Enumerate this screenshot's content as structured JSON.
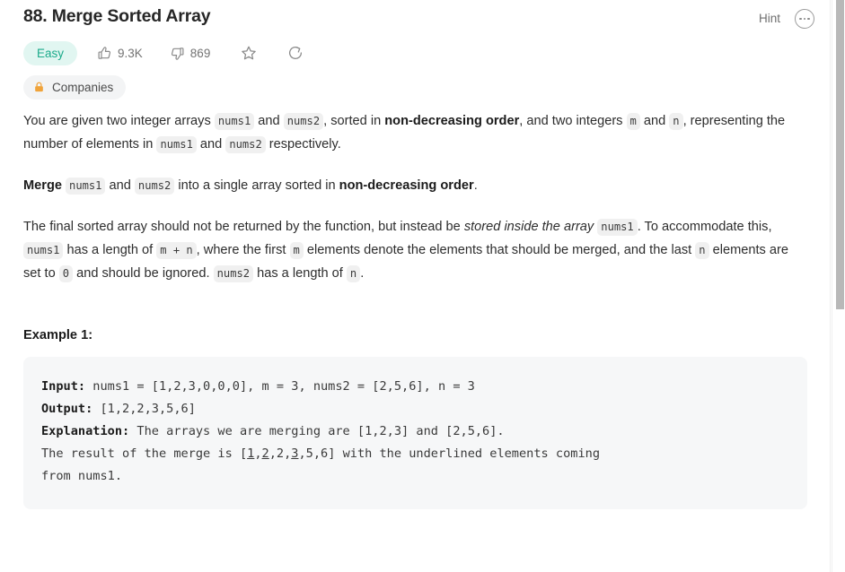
{
  "header": {
    "title": "88. Merge Sorted Array",
    "hint_label": "Hint",
    "more_icon": "ellipsis-circle-icon"
  },
  "meta": {
    "difficulty": "Easy",
    "difficulty_color": "#1cab8b",
    "difficulty_bg": "#e1f6f1",
    "upvotes": "9.3K",
    "downvotes": "869",
    "star_icon": "star-icon",
    "share_icon": "share-icon",
    "thumbs_up_icon": "thumbs-up-icon",
    "thumbs_down_icon": "thumbs-down-icon"
  },
  "tags": {
    "companies_label": "Companies",
    "lock_icon": "lock-icon",
    "lock_color": "#f0a33a"
  },
  "description": {
    "p1_a": "You are given two integer arrays ",
    "p1_code1": "nums1",
    "p1_b": " and ",
    "p1_code2": "nums2",
    "p1_c": ", sorted in ",
    "p1_bold1": "non-decreasing order",
    "p1_d": ", and two integers ",
    "p1_code3": "m",
    "p1_e": " and ",
    "p1_code4": "n",
    "p1_f": ", representing the number of elements in ",
    "p1_code5": "nums1",
    "p1_g": " and ",
    "p1_code6": "nums2",
    "p1_h": " respectively.",
    "p2_bold": "Merge",
    "p2_a": " ",
    "p2_code1": "nums1",
    "p2_b": " and ",
    "p2_code2": "nums2",
    "p2_c": " into a single array sorted in ",
    "p2_bold2": "non-decreasing order",
    "p2_d": ".",
    "p3_a": "The final sorted array should not be returned by the function, but instead be ",
    "p3_em": "stored inside the array",
    "p3_b": " ",
    "p3_code1": "nums1",
    "p3_c": ". To accommodate this, ",
    "p3_code2": "nums1",
    "p3_d": " has a length of ",
    "p3_code3": "m + n",
    "p3_e": ", where the first ",
    "p3_code4": "m",
    "p3_f": " elements denote the elements that should be merged, and the last ",
    "p3_code5": "n",
    "p3_g": " elements are set to ",
    "p3_code6": "0",
    "p3_h": " and should be ignored. ",
    "p3_code7": "nums2",
    "p3_i": " has a length of ",
    "p3_code8": "n",
    "p3_j": "."
  },
  "example": {
    "heading": "Example 1:",
    "input_label": "Input:",
    "input_value": " nums1 = [1,2,3,0,0,0], m = 3, nums2 = [2,5,6], n = 3",
    "output_label": "Output:",
    "output_value": " [1,2,2,3,5,6]",
    "explanation_label": "Explanation:",
    "explanation_part1": " The arrays we are merging are [1,2,3] and [2,5,6].",
    "explanation_part2": "The result of the merge is [",
    "underline_1": "1",
    "exp_sep1": ",",
    "underline_2": "2",
    "exp_sep2": ",2,",
    "underline_3": "3",
    "exp_sep3": ",5,6] with the underlined elements coming",
    "explanation_part3": "from nums1."
  },
  "scrollbar": {
    "thumb_color": "#b8b8b8"
  }
}
